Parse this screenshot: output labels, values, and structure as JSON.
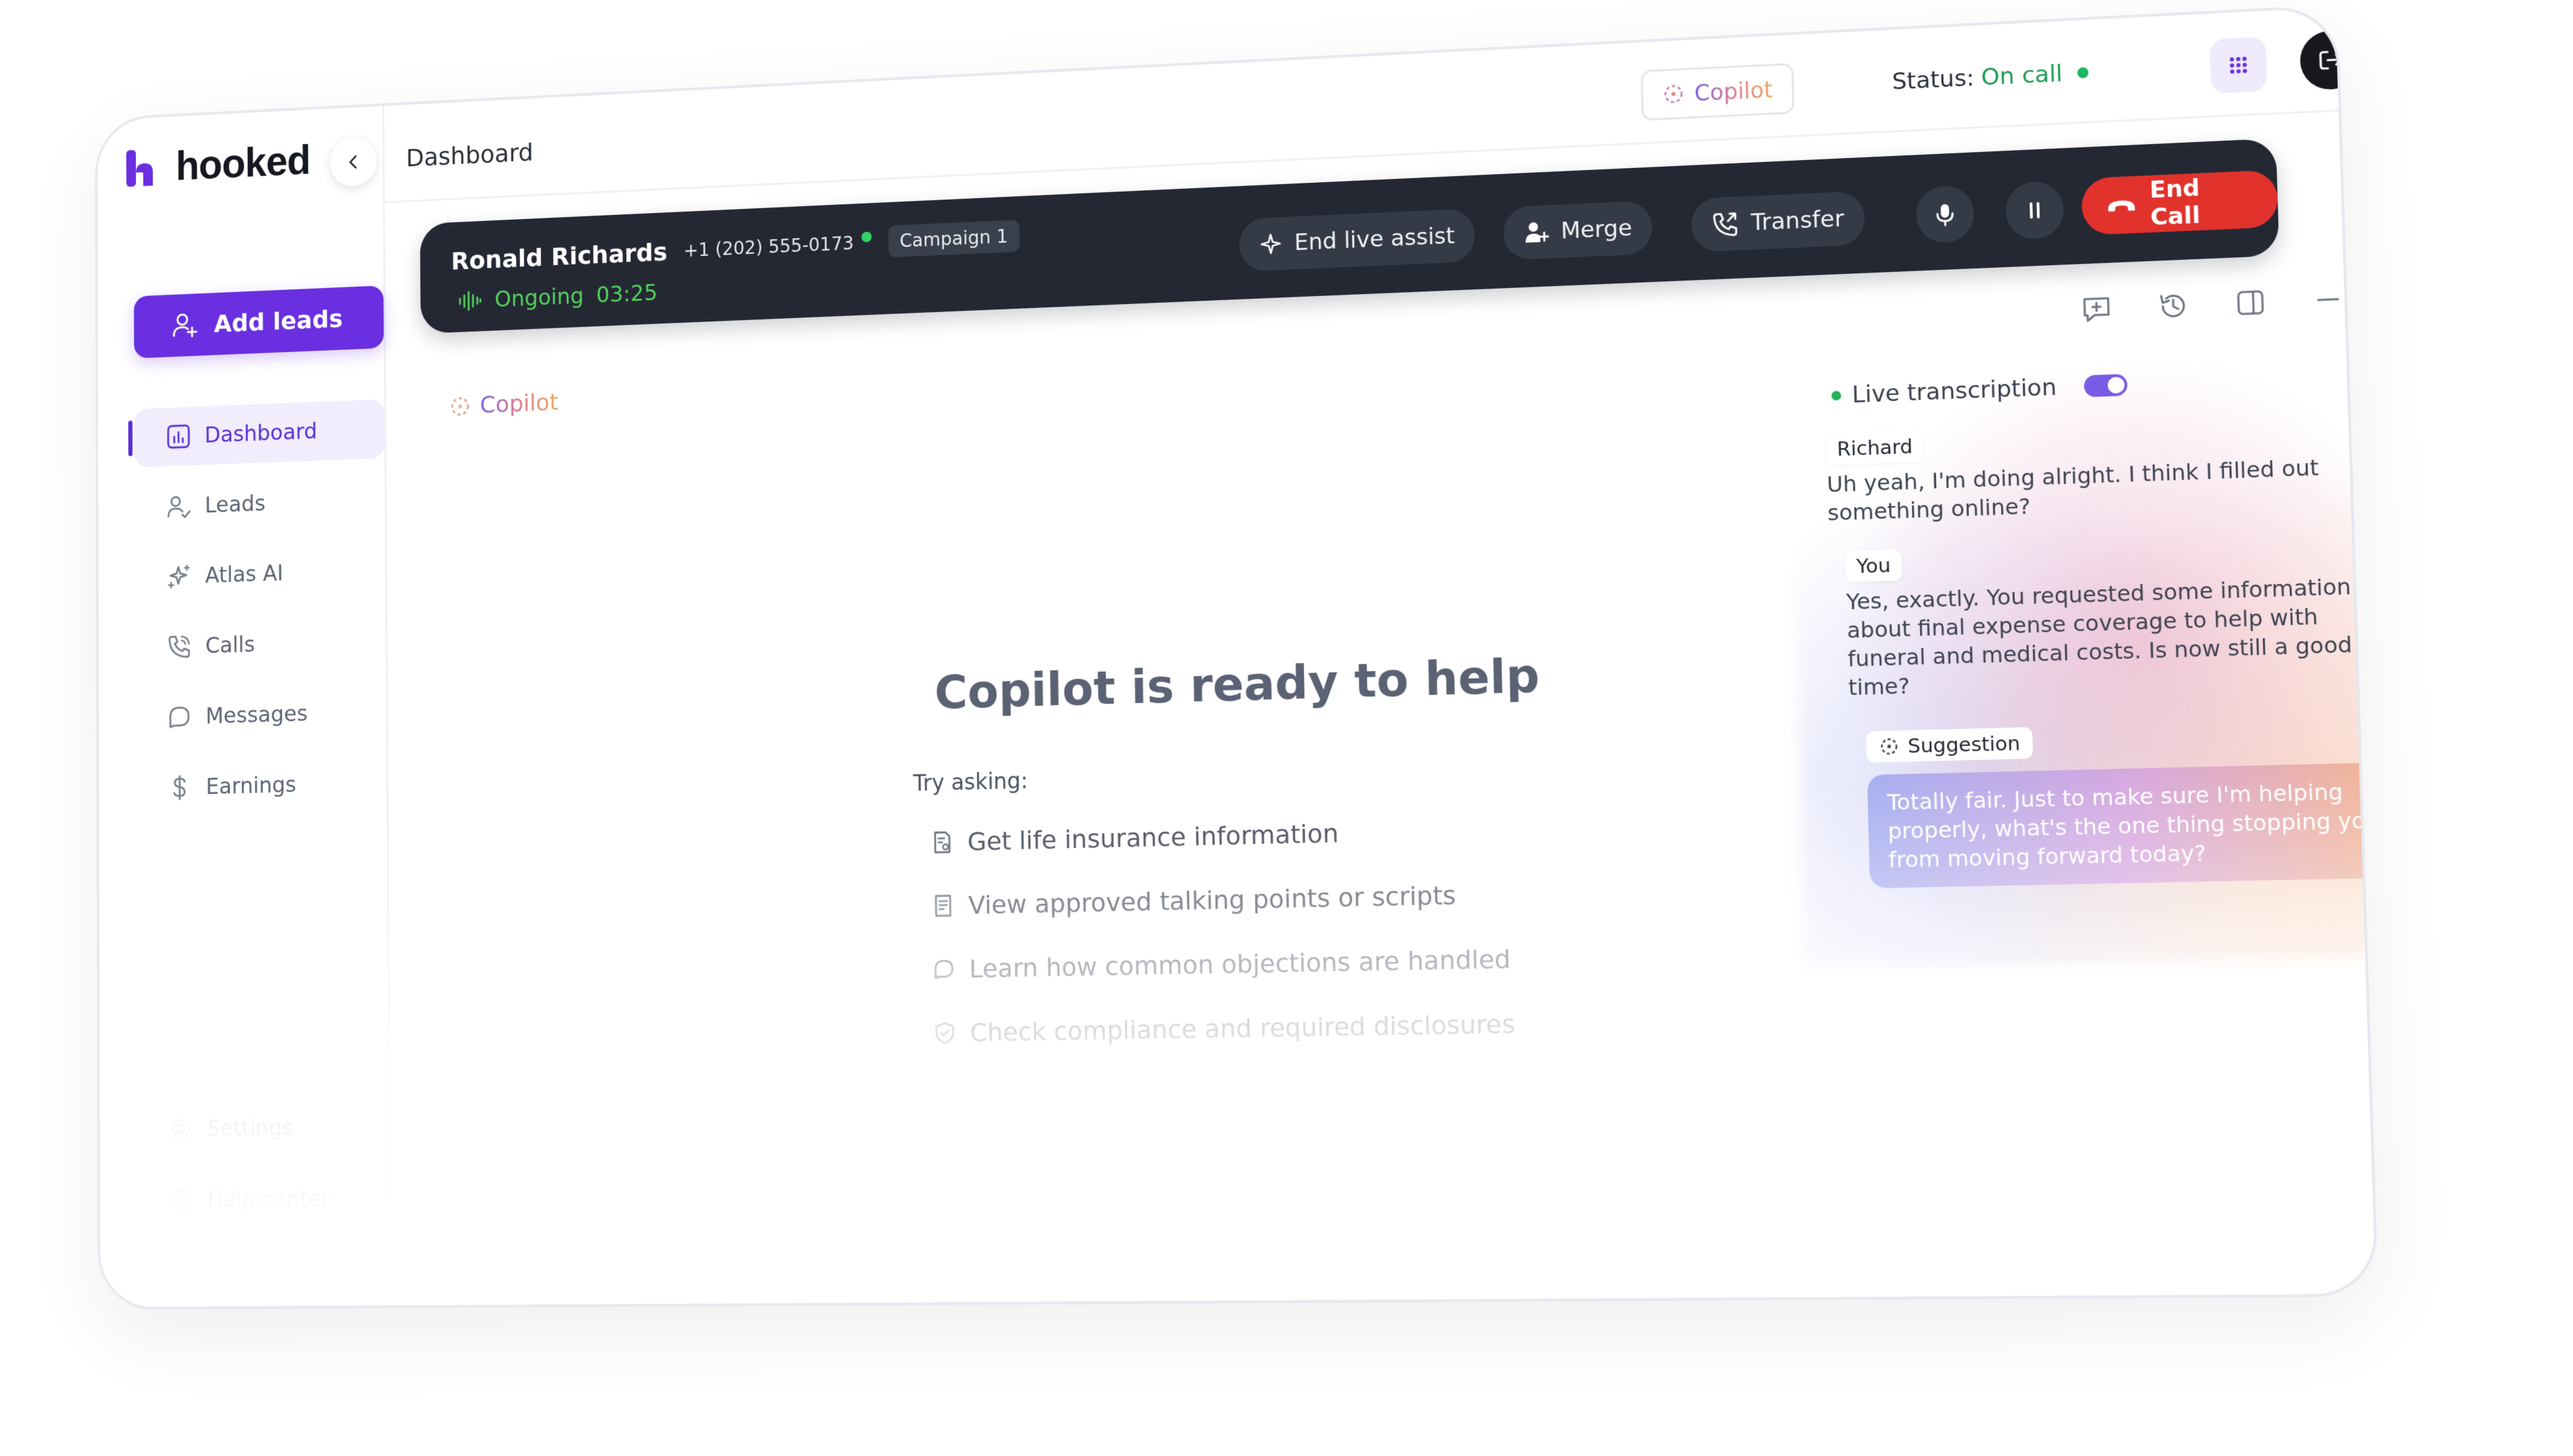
{
  "brand": {
    "name": "hooked",
    "accent": "#6a2fe0"
  },
  "sidebar": {
    "add_leads_label": "Add leads",
    "items": [
      {
        "label": "Dashboard",
        "icon": "chart-icon",
        "active": true
      },
      {
        "label": "Leads",
        "icon": "users-icon"
      },
      {
        "label": "Atlas AI",
        "icon": "sparkles-icon"
      },
      {
        "label": "Calls",
        "icon": "phone-icon"
      },
      {
        "label": "Messages",
        "icon": "chat-icon"
      },
      {
        "label": "Earnings",
        "icon": "dollar-icon"
      }
    ],
    "bottom_items": [
      {
        "label": "Settings",
        "icon": "gear-icon"
      },
      {
        "label": "Help center",
        "icon": "lifebuoy-icon"
      }
    ]
  },
  "header": {
    "title": "Dashboard",
    "copilot_label": "Copilot",
    "status_label": "Status:",
    "status_value": "On call"
  },
  "call": {
    "name": "Ronald Richards",
    "phone": "+1 (202) 555-0173",
    "campaign": "Campaign 1",
    "state": "Ongoing",
    "duration": "03:25",
    "end_live_assist": "End live assist",
    "merge": "Merge",
    "transfer": "Transfer",
    "end_call": "End Call",
    "end_call_color": "#e1322c"
  },
  "main": {
    "copilot_label": "Copilot",
    "ready_title": "Copilot is ready to help",
    "try_asking": "Try asking:",
    "suggestions": [
      "Get life insurance information",
      "View approved talking points or scripts",
      "Learn how common objections are handled",
      "Check compliance and required disclosures"
    ]
  },
  "transcript": {
    "live_label": "Live transcription",
    "messages": [
      {
        "speaker": "Richard",
        "text": "Uh yeah, I'm doing alright. I think I filled out something online?"
      },
      {
        "speaker": "You",
        "text": "Yes, exactly. You requested some information about final expense coverage to help with funeral and medical costs. Is now still a good time?"
      }
    ],
    "suggestion_label": "Suggestion",
    "suggestion_text": "Totally fair. Just to make sure I'm helping properly, what's the one thing stopping you from moving forward today?"
  }
}
